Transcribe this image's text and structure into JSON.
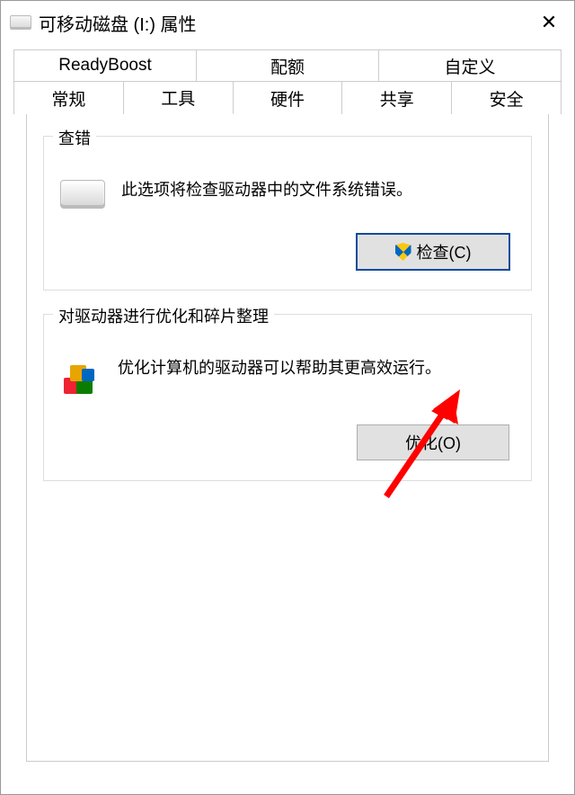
{
  "titlebar": {
    "title": "可移动磁盘 (I:) 属性"
  },
  "tabs_top": [
    {
      "label": "ReadyBoost"
    },
    {
      "label": "配额"
    },
    {
      "label": "自定义"
    }
  ],
  "tabs_bottom": [
    {
      "label": "常规"
    },
    {
      "label": "工具",
      "active": true
    },
    {
      "label": "硬件"
    },
    {
      "label": "共享"
    },
    {
      "label": "安全"
    }
  ],
  "groups": {
    "check": {
      "title": "查错",
      "desc": "此选项将检查驱动器中的文件系统错误。",
      "button": "检查(C)"
    },
    "optimize": {
      "title": "对驱动器进行优化和碎片整理",
      "desc": "优化计算机的驱动器可以帮助其更高效运行。",
      "button": "优化(O)"
    }
  }
}
